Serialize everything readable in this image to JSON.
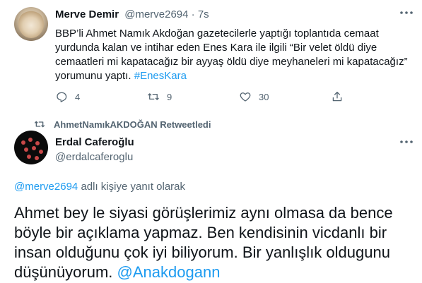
{
  "tweet1": {
    "author_name": "Merve Demir",
    "author_handle": "@merve2694",
    "separator": "·",
    "time": "7s",
    "text": "BBP’li Ahmet Namık Akdoğan gazetecilerle yaptığı toplantıda cemaat yurdunda kalan ve intihar eden Enes Kara ile ilgili “Bir velet öldü diye cemaatleri mi kapatacağız bir ayyaş öldü diye meyhaneleri mi kapatacağız” yorumunu yaptı.",
    "hashtag": "#EnesKara",
    "reply_count": "4",
    "retweet_count": "9",
    "like_count": "30"
  },
  "retweet_banner": {
    "label": "AhmetNamıkAKDOĞAN Retweetledi"
  },
  "tweet2": {
    "author_name": "Erdal Caferoğlu",
    "author_handle": "@erdalcaferoglu",
    "replying_mention": "@merve2694",
    "replying_suffix": "adlı kişiye yanıt olarak",
    "text": "Ahmet bey le siyasi görüşlerimiz aynı olmasa da bence böyle bir açıklama yapmaz. Ben kendisinin vicdanlı bir insan olduğunu çok iyi biliyorum. Bir yanlışlık oldugunu düşünüyorum.",
    "mention": "@Anakdogann"
  },
  "icons": {
    "more": "more-icon",
    "reply": "reply-icon",
    "retweet": "retweet-icon",
    "like": "heart-icon",
    "share": "share-icon"
  },
  "colors": {
    "link": "#1d9bf0",
    "secondary_text": "#536471",
    "primary_text": "#0f1419"
  }
}
